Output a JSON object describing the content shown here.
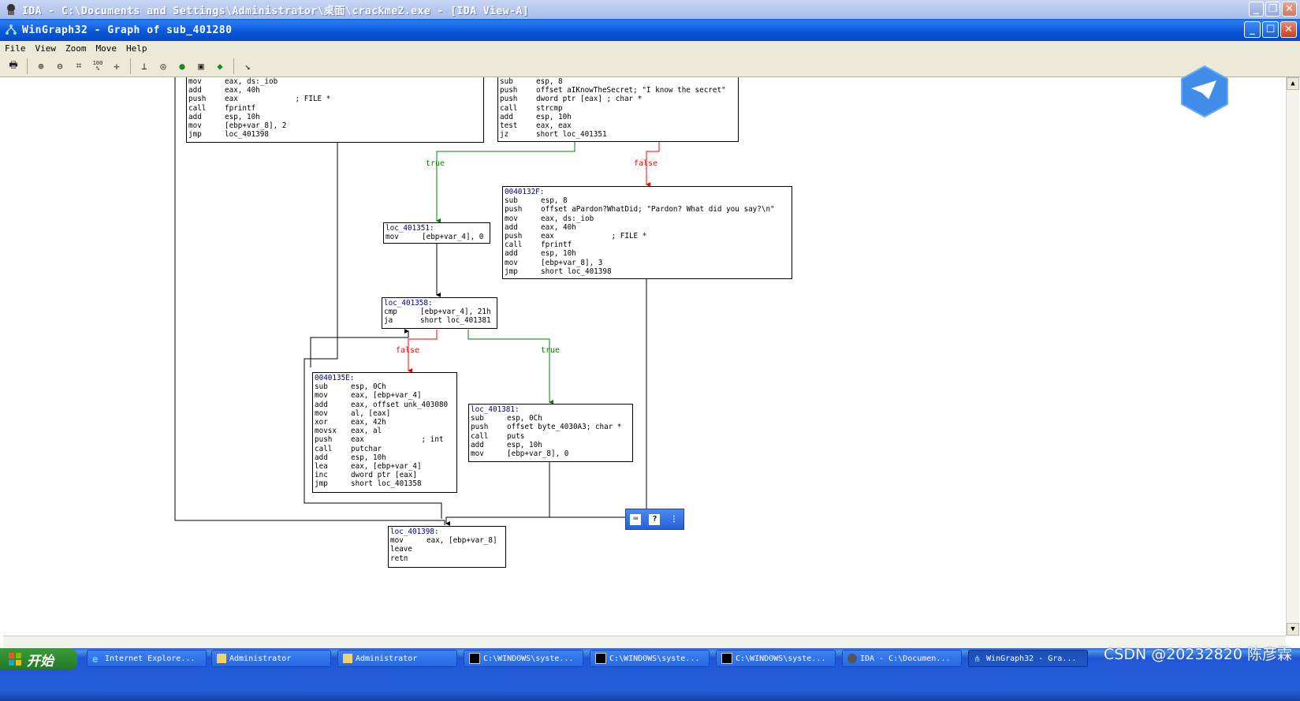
{
  "ida_window": {
    "title": "IDA - C:\\Documents and Settings\\Administrator\\桌面\\crackme2.exe - [IDA View-A]"
  },
  "wingraph_window": {
    "title": "WinGraph32 - Graph of sub_401280"
  },
  "menu": {
    "file": "File",
    "view": "View",
    "zoom": "Zoom",
    "move": "Move",
    "help": "Help"
  },
  "toolbar": {
    "icons": [
      "print-icon",
      "zoom-in-icon",
      "zoom-out-icon",
      "fit-window-icon",
      "zoom-100-icon",
      "center-icon",
      "move-origin-icon",
      "rotate-icon",
      "color-icon",
      "layout-icon",
      "export-icon",
      "pointer-icon"
    ],
    "zoom100_label": "100\n%"
  },
  "graph": {
    "nodes": {
      "top_left": {
        "lines": [
          [
            "mov",
            "eax, ds:_iob"
          ],
          [
            "add",
            "eax, 40h"
          ],
          [
            "push",
            "eax             ; FILE *"
          ],
          [
            "call",
            "fprintf"
          ],
          [
            "add",
            "esp, 10h"
          ],
          [
            "mov",
            "[ebp+var_8], 2"
          ],
          [
            "jmp",
            "loc_401398"
          ]
        ]
      },
      "top_right": {
        "lines": [
          [
            "sub",
            "esp, 8"
          ],
          [
            "push",
            "offset aIKnowTheSecret; \"I know the secret\""
          ],
          [
            "push",
            "dword ptr [eax] ; char *"
          ],
          [
            "call",
            "strcmp"
          ],
          [
            "add",
            "esp, 10h"
          ],
          [
            "test",
            "eax, eax"
          ],
          [
            "jz",
            "short loc_401351"
          ]
        ]
      },
      "n40132f": {
        "label": "0040132F:",
        "lines": [
          [
            "sub",
            "esp, 8"
          ],
          [
            "push",
            "offset aPardon?WhatDid; \"Pardon? What did you say?\\n\""
          ],
          [
            "mov",
            "eax, ds:_iob"
          ],
          [
            "add",
            "eax, 40h"
          ],
          [
            "push",
            "eax             ; FILE *"
          ],
          [
            "call",
            "fprintf"
          ],
          [
            "add",
            "esp, 10h"
          ],
          [
            "mov",
            "[ebp+var_8], 3"
          ],
          [
            "jmp",
            "short loc_401398"
          ]
        ]
      },
      "loc_401351": {
        "label": "loc_401351:",
        "lines": [
          [
            "mov",
            "[ebp+var_4], 0"
          ]
        ]
      },
      "loc_401358": {
        "label": "loc_401358:",
        "lines": [
          [
            "cmp",
            "[ebp+var_4], 21h"
          ],
          [
            "ja",
            "short loc_401381"
          ]
        ]
      },
      "n40135e": {
        "label": "0040135E:",
        "lines": [
          [
            "sub",
            "esp, 0Ch"
          ],
          [
            "mov",
            "eax, [ebp+var_4]"
          ],
          [
            "add",
            "eax, offset unk_403080"
          ],
          [
            "mov",
            "al, [eax]"
          ],
          [
            "xor",
            "eax, 42h"
          ],
          [
            "movsx",
            "eax, al"
          ],
          [
            "push",
            "eax             ; int"
          ],
          [
            "call",
            "putchar"
          ],
          [
            "add",
            "esp, 10h"
          ],
          [
            "lea",
            "eax, [ebp+var_4]"
          ],
          [
            "inc",
            "dword ptr [eax]"
          ],
          [
            "jmp",
            "short loc_401358"
          ]
        ]
      },
      "loc_401381": {
        "label": "loc_401381:",
        "lines": [
          [
            "sub",
            "esp, 0Ch"
          ],
          [
            "push",
            "offset byte_4030A3; char *"
          ],
          [
            "call",
            "puts"
          ],
          [
            "add",
            "esp, 10h"
          ],
          [
            "mov",
            "[ebp+var_8], 0"
          ]
        ]
      },
      "loc_401398": {
        "label": "loc_401398:",
        "lines": [
          [
            "mov",
            "eax, [ebp+var_8]"
          ],
          [
            "leave",
            ""
          ],
          [
            "retn",
            ""
          ]
        ]
      }
    },
    "edge_labels": {
      "true1": "true",
      "false1": "false",
      "false2": "false",
      "true2": "true"
    },
    "colors": {
      "true": "#008000",
      "false": "#ff0000",
      "normal": "#000000",
      "label": "#000080"
    }
  },
  "taskbar": {
    "start": "开始",
    "tasks": [
      "Internet Explore...",
      "Administrator",
      "Administrator",
      "C:\\WINDOWS\\syste...",
      "C:\\WINDOWS\\syste...",
      "C:\\WINDOWS\\syste...",
      "IDA - C:\\Documen...",
      "WinGraph32 - Gra..."
    ],
    "watermark": "CSDN @20232820 陈彦霖"
  }
}
